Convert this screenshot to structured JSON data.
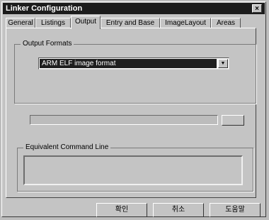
{
  "window": {
    "title": "Linker Configuration",
    "close_glyph": "×"
  },
  "tabs": [
    {
      "label": "General"
    },
    {
      "label": "Listings"
    },
    {
      "label": "Output",
      "active": true
    },
    {
      "label": "Entry and Base"
    },
    {
      "label": "ImageLayout"
    },
    {
      "label": "Areas"
    }
  ],
  "output_formats": {
    "group_label": "Output Formats",
    "selected": "ARM ELF image format",
    "dropdown_glyph": "▼"
  },
  "command_line": {
    "group_label": "Equivalent Command Line",
    "value": ""
  },
  "buttons": {
    "ok": "확인",
    "cancel": "취소",
    "help": "도움말"
  }
}
